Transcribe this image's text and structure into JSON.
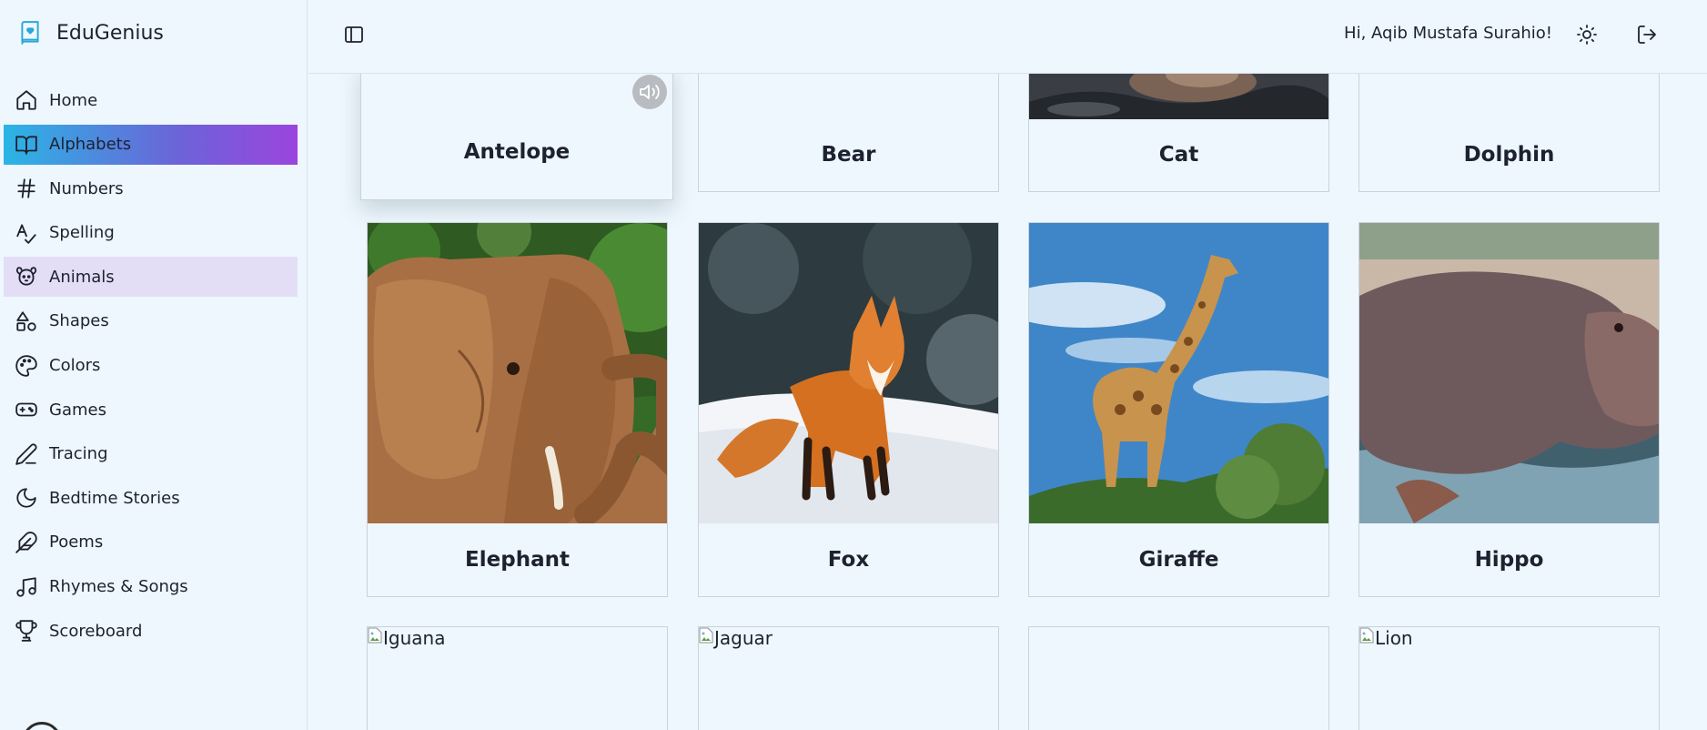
{
  "brand": {
    "name": "EduGenius",
    "logo_icon": "book-heart-icon",
    "accent": "#2aa8d8"
  },
  "nav": {
    "items": [
      {
        "label": "Home",
        "icon": "home-icon"
      },
      {
        "label": "Alphabets",
        "icon": "book-open-icon",
        "state": "active"
      },
      {
        "label": "Numbers",
        "icon": "hash-icon"
      },
      {
        "label": "Spelling",
        "icon": "spell-check-icon"
      },
      {
        "label": "Animals",
        "icon": "paw-icon",
        "state": "hover"
      },
      {
        "label": "Shapes",
        "icon": "shapes-icon"
      },
      {
        "label": "Colors",
        "icon": "palette-icon"
      },
      {
        "label": "Games",
        "icon": "gamepad-icon"
      },
      {
        "label": "Tracing",
        "icon": "pen-icon"
      },
      {
        "label": "Bedtime Stories",
        "icon": "moon-icon"
      },
      {
        "label": "Poems",
        "icon": "feather-icon"
      },
      {
        "label": "Rhymes & Songs",
        "icon": "music-icon"
      },
      {
        "label": "Scoreboard",
        "icon": "trophy-icon"
      }
    ],
    "active_gradient": [
      "#2bb5e5",
      "#9b45de"
    ],
    "hover_color": "#e3def5"
  },
  "header": {
    "greeting": "Hi, Aqib Mustafa Surahio!",
    "toggle_icon": "sidebar-toggle-icon",
    "theme_icon": "sun-icon",
    "logout_icon": "logout-icon"
  },
  "cards": [
    {
      "name": "Antelope",
      "image": "none-visible"
    },
    {
      "name": "Bear",
      "image": "none-visible"
    },
    {
      "name": "Cat",
      "image": "cat-photo"
    },
    {
      "name": "Dolphin",
      "image": "none-visible"
    },
    {
      "name": "Elephant",
      "image": "elephant-photo"
    },
    {
      "name": "Fox",
      "image": "fox-photo"
    },
    {
      "name": "Giraffe",
      "image": "giraffe-photo"
    },
    {
      "name": "Hippo",
      "image": "hippo-photo"
    },
    {
      "name": "Iguana",
      "image": "broken-image",
      "alt": "Iguana"
    },
    {
      "name": "Jaguar",
      "image": "broken-image",
      "alt": "Jaguar"
    },
    {
      "name": "",
      "image": "blank"
    },
    {
      "name": "Lion",
      "image": "broken-image",
      "alt": "Lion"
    }
  ]
}
